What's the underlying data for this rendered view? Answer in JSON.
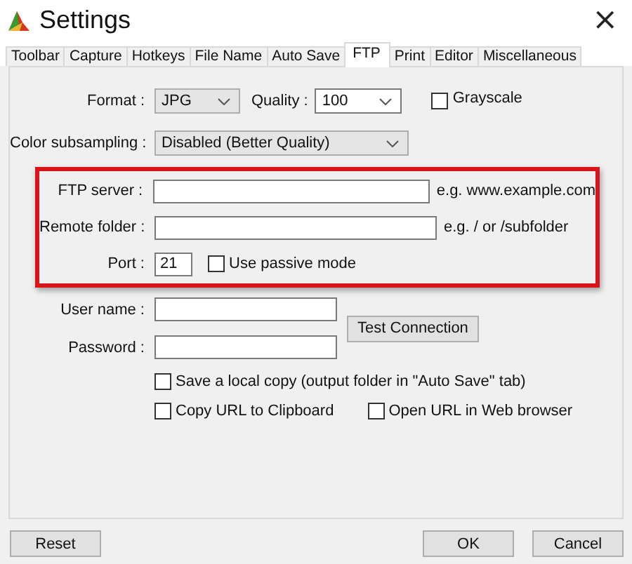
{
  "window": {
    "title": "Settings",
    "close": "×"
  },
  "tabs": [
    {
      "label": "Toolbar",
      "selected": false
    },
    {
      "label": "Capture",
      "selected": false
    },
    {
      "label": "Hotkeys",
      "selected": false
    },
    {
      "label": "File Name",
      "selected": false
    },
    {
      "label": "Auto Save",
      "selected": false
    },
    {
      "label": "FTP",
      "selected": true
    },
    {
      "label": "Print",
      "selected": false
    },
    {
      "label": "Editor",
      "selected": false
    },
    {
      "label": "Miscellaneous",
      "selected": false
    }
  ],
  "format": {
    "label": "Format :",
    "value": "JPG"
  },
  "quality": {
    "label": "Quality :",
    "value": "100"
  },
  "grayscale": {
    "label": "Grayscale",
    "checked": false
  },
  "color_subsampling": {
    "label": "Color subsampling :",
    "value": "Disabled (Better Quality)"
  },
  "ftp_server": {
    "label": "FTP server :",
    "hint": "e.g. www.example.com"
  },
  "remote_folder": {
    "label": "Remote folder :",
    "hint": "e.g. / or /subfolder"
  },
  "port": {
    "label": "Port :",
    "value": "21"
  },
  "passive_mode": {
    "label": "Use passive mode",
    "checked": false
  },
  "user_name": {
    "label": "User name :"
  },
  "password": {
    "label": "Password :"
  },
  "test_button": "Test Connection",
  "local_copy": {
    "label": "Save a local copy (output folder in \"Auto Save\" tab)",
    "checked": false
  },
  "copy_url": {
    "label": "Copy URL to Clipboard",
    "checked": false
  },
  "open_url": {
    "label": "Open URL in Web browser",
    "checked": false
  },
  "buttons": {
    "reset": "Reset",
    "ok": "OK",
    "cancel": "Cancel"
  }
}
